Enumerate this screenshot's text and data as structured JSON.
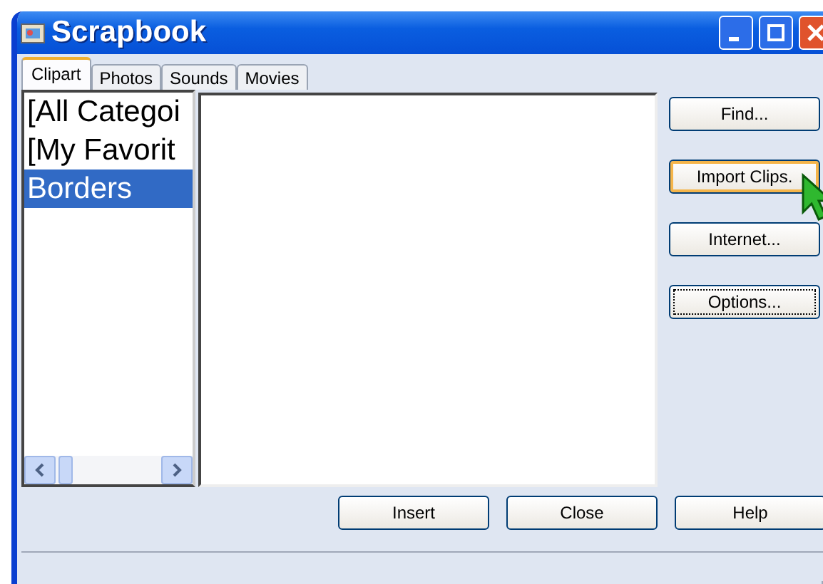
{
  "window": {
    "title": "Scrapbook"
  },
  "tabs": [
    {
      "label": "Clipart",
      "selected": true
    },
    {
      "label": "Photos",
      "selected": false
    },
    {
      "label": "Sounds",
      "selected": false
    },
    {
      "label": "Movies",
      "selected": false
    }
  ],
  "categories": [
    {
      "label": "[All Categoi",
      "selected": false
    },
    {
      "label": "[My Favorit",
      "selected": false
    },
    {
      "label": "Borders",
      "selected": true
    }
  ],
  "side_buttons": [
    {
      "label": "Find...",
      "hovered": false,
      "focused": false
    },
    {
      "label": "Import Clips.",
      "hovered": true,
      "focused": false
    },
    {
      "label": "Internet...",
      "hovered": false,
      "focused": false
    },
    {
      "label": "Options...",
      "hovered": false,
      "focused": true
    }
  ],
  "bottom_buttons": [
    "Insert",
    "Close",
    "Help"
  ]
}
